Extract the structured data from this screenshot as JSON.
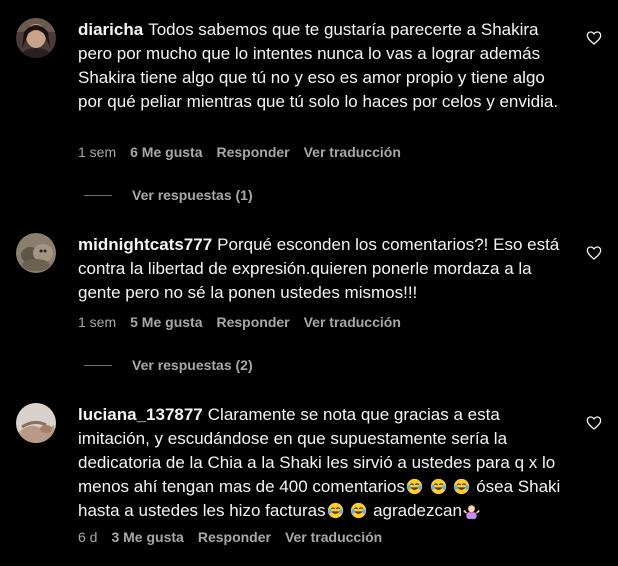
{
  "comments": [
    {
      "username": "diaricha",
      "text": "Todos sabemos que te gustaría parecerte a Shakira pero por mucho que lo intentes nunca lo vas a lograr además Shakira tiene algo que tú no y eso es amor propio y tiene algo por qué peliar mientras que tú solo lo haces por celos y envidia.",
      "time": "1 sem",
      "likes": "6 Me gusta",
      "reply": "Responder",
      "translate": "Ver traducción",
      "view_replies": "Ver respuestas (1)"
    },
    {
      "username": "midnightcats777",
      "text": "Porqué esconden los comentarios?! Eso está contra la libertad de expresión.quieren ponerle mordaza a la gente pero no sé la ponen ustedes mismos!!!",
      "time": "1 sem",
      "likes": "5 Me gusta",
      "reply": "Responder",
      "translate": "Ver traducción",
      "view_replies": "Ver respuestas (2)"
    },
    {
      "username": "luciana_137877",
      "text_part1": "Claramente se nota que gracias a esta imitación, y escudándose en que supuestamente sería la dedicatoria de la Chia a la Shaki les sirvió a ustedes para q x lo menos ahí tengan mas de 400 comentarios",
      "text_part2": "ósea Shaki hasta a ustedes les hizo facturas",
      "text_part3": "agradezcan",
      "time": "6 d",
      "likes": "3 Me gusta",
      "reply": "Responder",
      "translate": "Ver traducción"
    }
  ],
  "icons": {
    "heart": "heart-outline-icon",
    "laugh": "face-with-tears-of-joy-emoji",
    "shrug": "woman-shrugging-emoji"
  },
  "colors": {
    "background": "#000000",
    "text": "#f5f5f5",
    "secondary": "#a8a8a8"
  }
}
